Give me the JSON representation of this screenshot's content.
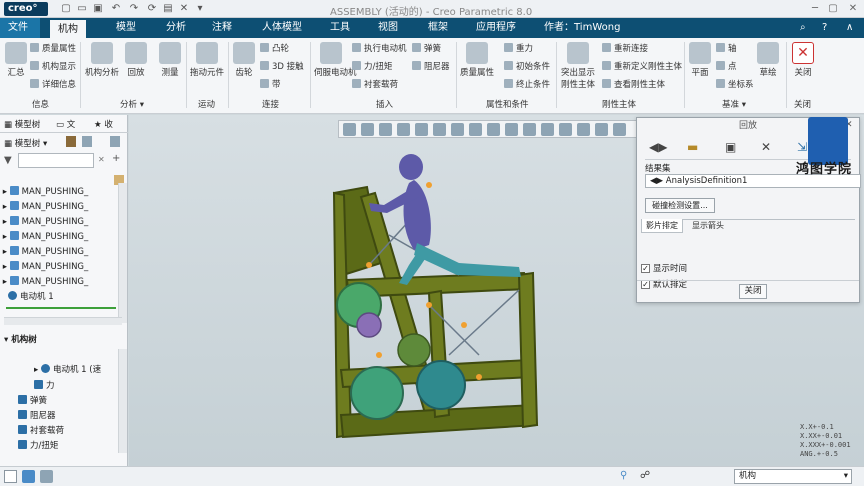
{
  "app": {
    "logo": "creo°",
    "title": "ASSEMBLY (活动的) - Creo Parametric 8.0"
  },
  "tabs": [
    "文件",
    "机构",
    "模型",
    "分析",
    "注释",
    "人体模型",
    "工具",
    "视图",
    "框架",
    "应用程序",
    "作者：TimWong"
  ],
  "ribbon": {
    "summary": "汇总",
    "mass": "质量属性",
    "mech_display": "机构显示",
    "detail": "详细信息",
    "g_info": "信息",
    "mech_analysis": "机构分析",
    "playback": "回放",
    "measure": "测量",
    "g_analysis": "分析",
    "drag": "拖动元件",
    "g_motion": "运动",
    "gear": "齿轮",
    "cam": "凸轮",
    "3d": "3D 接触",
    "belt": "带",
    "g_conn": "连接",
    "servo": "伺服电动机",
    "exec_motor": "执行电动机",
    "force_torque": "力/扭矩",
    "bushing": "衬套载荷",
    "spring": "弹簧",
    "damper": "阻尼器",
    "g_insert": "插入",
    "mass_prop": "质量属性",
    "gravity": "重力",
    "init": "初始条件",
    "terminate": "终止条件",
    "g_props": "属性和条件",
    "highlight_rb": "突出显示刚性主体",
    "redefine": "重新连接",
    "redef_rb": "重新定义刚性主体",
    "view_rb": "查看刚性主体",
    "g_rb": "刚性主体",
    "plane": "平面",
    "axis": "轴",
    "point": "点",
    "csys": "坐标系",
    "curve": "草绘",
    "g_datum": "基准",
    "close": "关闭",
    "g_close": "关闭"
  },
  "left": {
    "tab_model": "模型树",
    "tab_file": "文",
    "tab_fav": "收",
    "header": "模型树",
    "items": [
      "MAN_PUSHING_",
      "MAN_PUSHING_",
      "MAN_PUSHING_",
      "MAN_PUSHING_",
      "MAN_PUSHING_",
      "MAN_PUSHING_",
      "MAN_PUSHING_"
    ],
    "motor": "电动机 1",
    "mech_tree": "机构树",
    "mech_items": [
      "电动机 1 (速",
      "力",
      "弹簧",
      "阻尼器",
      "衬套载荷",
      "力/扭矩"
    ]
  },
  "dialog": {
    "title": "回放",
    "results": "结果集",
    "analysis": "AnalysisDefinition1",
    "collision": "碰撞检测设置...",
    "tab1": "影片排定",
    "tab2": "显示箭头",
    "show_time": "显示时间",
    "default": "默认排定",
    "close": "关闭"
  },
  "watermark": "鸿图学院",
  "tolerance": [
    "X.X+-0.1",
    "X.XX+-0.01",
    "X.XXX+-0.001",
    "ANG.+-0.5"
  ],
  "status": {
    "filter": "机构"
  }
}
